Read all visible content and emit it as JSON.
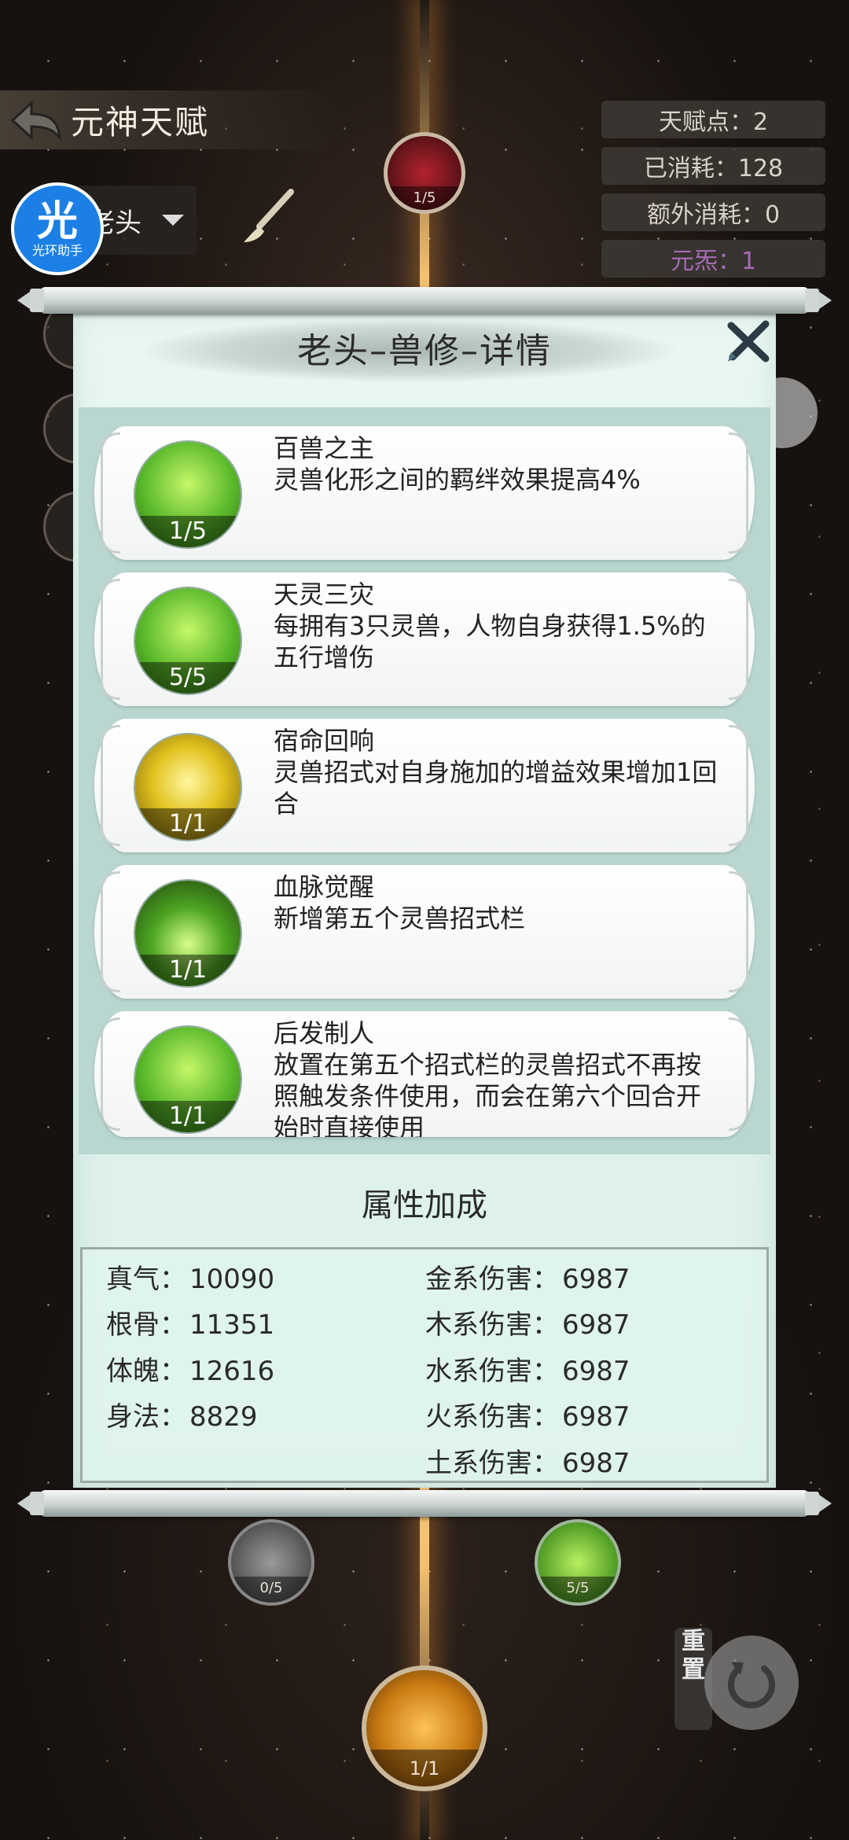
{
  "header": {
    "title": "元神天赋",
    "stats": {
      "talent_points": "天赋点：2",
      "consumed": "已消耗：128",
      "extra_consumed": "额外消耗：0",
      "yuansha": "元炁：1"
    },
    "character": "老头",
    "assist_badge": {
      "big": "光",
      "small": "光环助手"
    }
  },
  "tree": {
    "top_node_level": "1/5",
    "bottom_left_level": "0/5",
    "bottom_right_level": "5/5",
    "bottom_center_level": "1/1"
  },
  "panel": {
    "title": "老头–兽修–详情",
    "talents": [
      {
        "name": "百兽之主",
        "desc": "灵兽化形之间的羁绊效果提高4%",
        "level": "1/5",
        "icon": "beast-lord-icon"
      },
      {
        "name": "天灵三灾",
        "desc": "每拥有3只灵兽，人物自身获得1.5%的五行增伤",
        "level": "5/5",
        "icon": "three-calamities-icon"
      },
      {
        "name": "宿命回响",
        "desc": "灵兽招式对自身施加的增益效果增加1回合",
        "level": "1/1",
        "icon": "fate-echo-icon"
      },
      {
        "name": "血脉觉醒",
        "desc": "新增第五个灵兽招式栏",
        "level": "1/1",
        "icon": "bloodline-awaken-icon"
      },
      {
        "name": "后发制人",
        "desc": "放置在第五个招式栏的灵兽招式不再按照触发条件使用，而会在第六个回合开始时直接使用",
        "level": "1/1",
        "icon": "counterstrike-icon"
      }
    ],
    "attributes_title": "属性加成",
    "attributes_left": [
      {
        "key": "真气：",
        "value": "10090"
      },
      {
        "key": "根骨：",
        "value": "11351"
      },
      {
        "key": "体魄：",
        "value": "12616"
      },
      {
        "key": "身法：",
        "value": "8829"
      }
    ],
    "attributes_right": [
      {
        "key": "金系伤害：",
        "value": "6987"
      },
      {
        "key": "木系伤害：",
        "value": "6987"
      },
      {
        "key": "水系伤害：",
        "value": "6987"
      },
      {
        "key": "火系伤害：",
        "value": "6987"
      },
      {
        "key": "土系伤害：",
        "value": "6987"
      }
    ]
  },
  "reset": {
    "label": "重置"
  },
  "colors": {
    "accent_glow": "#f4c070",
    "paper": "#e2f4ee",
    "list_bg": "#b9d7d0",
    "purple_text": "#a46bb4"
  }
}
